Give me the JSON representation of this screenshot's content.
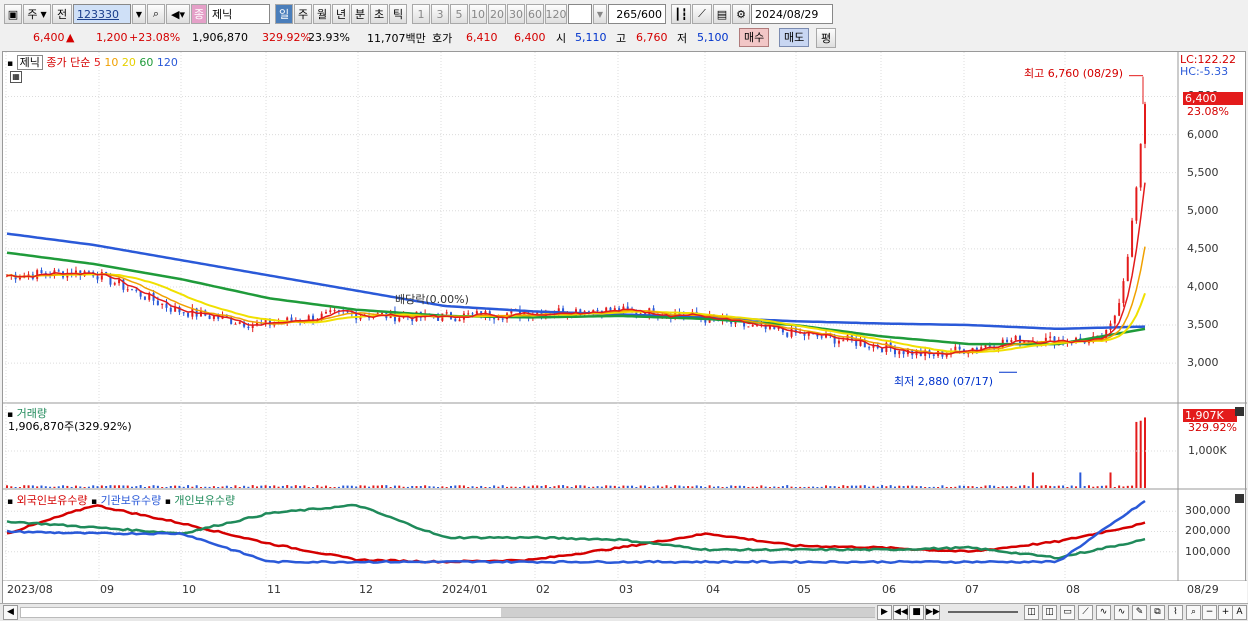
{
  "toolbar": {
    "market": "주",
    "scope": "전",
    "code": "123330",
    "search_icon": "search-icon",
    "sound_icon": "speaker-icon",
    "type_badge": "종",
    "stock_name": "제닉",
    "periods": [
      "일",
      "주",
      "월",
      "년",
      "분",
      "초",
      "틱"
    ],
    "active_period": "일",
    "minute_options": [
      "1",
      "3",
      "5",
      "10",
      "20",
      "30",
      "60",
      "120"
    ],
    "count": "265",
    "count_max": "/600",
    "date": "2024/08/29"
  },
  "quote": {
    "price": "6,400",
    "change_arrow": "▲",
    "change": "1,200",
    "change_pct": "+23.08%",
    "volume": "1,906,870",
    "volume_ratio": "329.92%",
    "turnover": "23.93%",
    "amount": "11,707백만",
    "bid_label": "호가",
    "ask_price": "6,410",
    "bid_price": "6,400",
    "open_label": "시",
    "open": "5,110",
    "high_label": "고",
    "high": "6,760",
    "low_label": "저",
    "low": "5,100",
    "buy_button": "매수",
    "sell_button": "매도",
    "eval_button": "평"
  },
  "price_panel": {
    "legend_name": "제닉",
    "legend_ma": "종가 단순",
    "ma_periods": [
      {
        "label": "5",
        "color": "#e31b1b"
      },
      {
        "label": "10",
        "color": "#f0a000"
      },
      {
        "label": "20",
        "color": "#f0e000"
      },
      {
        "label": "60",
        "color": "#1f9b3a"
      },
      {
        "label": "120",
        "color": "#2a59d8"
      }
    ],
    "lc": "LC:122.22",
    "hc": "HC:-5.33",
    "y_ticks": [
      "6,500",
      "6,000",
      "5,500",
      "5,000",
      "4,500",
      "4,000",
      "3,500",
      "3,000"
    ],
    "last_price_tag": "6,400",
    "last_pct_tag": "23.08%",
    "high_annotation": "최고 6,760 (08/29)",
    "low_annotation": "최저 2,880 (07/17)",
    "dividend_annotation": "배당락(0.00%)"
  },
  "volume_panel": {
    "title": "거래량",
    "current": "1,906,870주(329.92%)",
    "tag": "1,907K",
    "tag_pct": "329.92%",
    "y_tick": "1,000K"
  },
  "holdings_panel": {
    "series": [
      {
        "label": "외국인보유수량",
        "color": "#d40000"
      },
      {
        "label": "기관보유수량",
        "color": "#2a59d8"
      },
      {
        "label": "개인보유수량",
        "color": "#1f8a5a"
      }
    ],
    "y_ticks": [
      "300,000",
      "200,000",
      "100,000"
    ]
  },
  "x_axis": [
    "2023/08",
    "09",
    "10",
    "11",
    "12",
    "2024/01",
    "02",
    "03",
    "04",
    "05",
    "06",
    "07",
    "08",
    "08/29"
  ],
  "chart_data": {
    "type": "line",
    "x": [
      "2023/08",
      "09",
      "10",
      "11",
      "12",
      "2024/01",
      "02",
      "03",
      "04",
      "05",
      "06",
      "07",
      "08",
      "08/29"
    ],
    "series": [
      {
        "name": "제닉",
        "values": [
          4150,
          4200,
          3700,
          3500,
          3650,
          3600,
          3650,
          3700,
          3650,
          3450,
          3300,
          3100,
          3300,
          6400
        ]
      },
      {
        "name": "120",
        "values": [
          4700,
          4550,
          4350,
          4150,
          3950,
          3750,
          3680,
          3640,
          3600,
          3550,
          3520,
          3500,
          3450,
          3480
        ]
      },
      {
        "name": "60",
        "values": [
          4450,
          4300,
          4100,
          3850,
          3700,
          3620,
          3600,
          3620,
          3580,
          3500,
          3350,
          3250,
          3250,
          3450
        ]
      }
    ],
    "ylim": [
      2700,
      6900
    ]
  }
}
